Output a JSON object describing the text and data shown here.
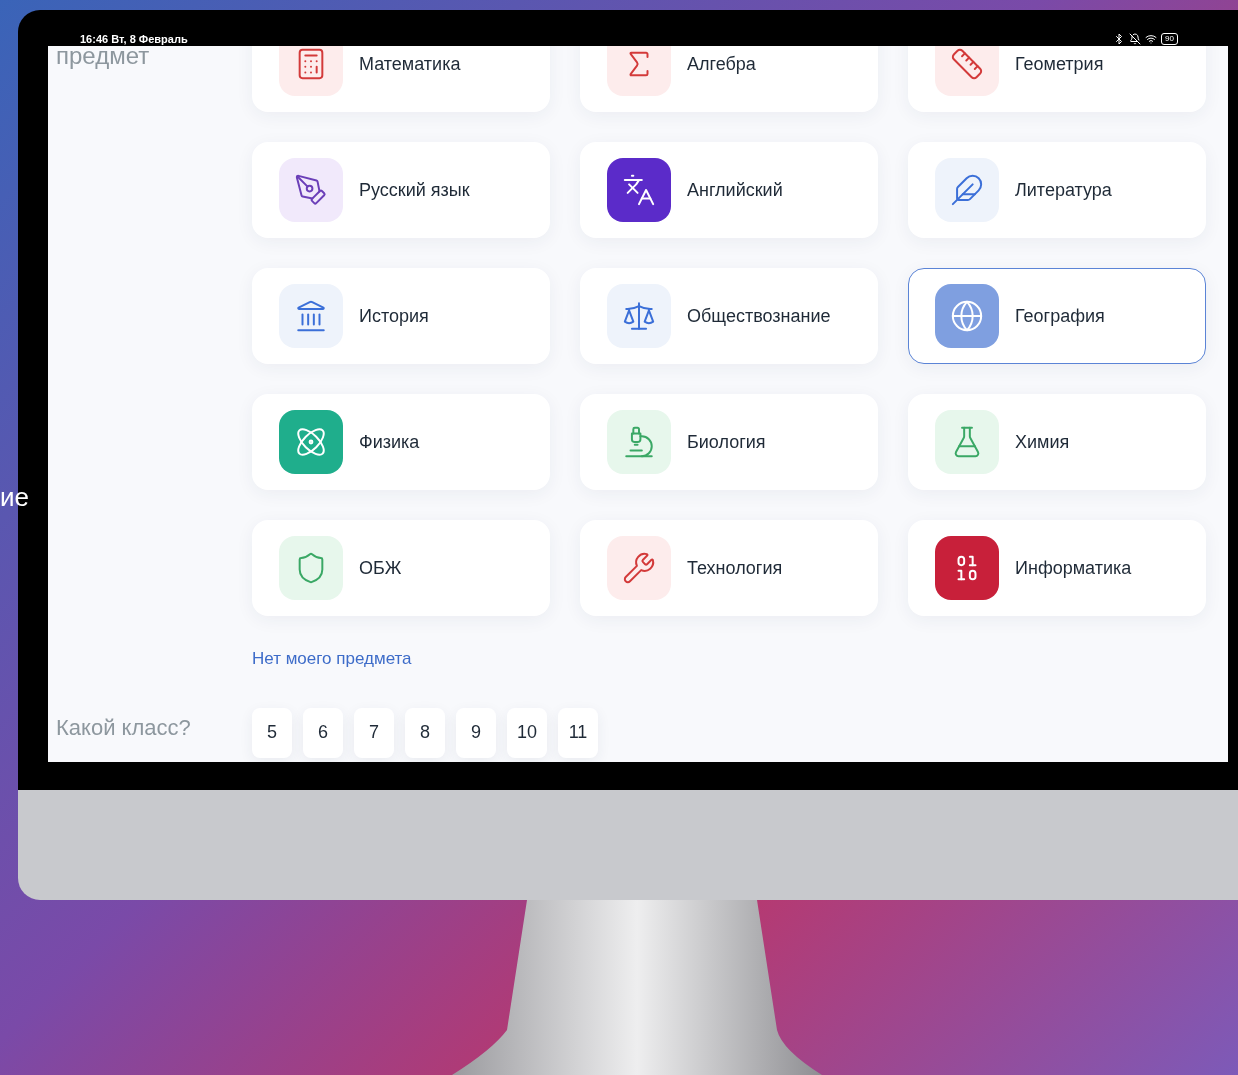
{
  "slide": {
    "text": "ие"
  },
  "status_bar": {
    "time": "16:46  Вт, 8 Февраль",
    "battery": "90"
  },
  "subject_label": "предмет",
  "subjects": [
    {
      "name": "Математика",
      "kind": "math",
      "color": "#fdecec",
      "selected": false
    },
    {
      "name": "Алгебра",
      "kind": "algebra",
      "color": "#fdecec",
      "selected": false
    },
    {
      "name": "Геометрия",
      "kind": "geometry",
      "color": "#fdecec",
      "selected": false
    },
    {
      "name": "Русский язык",
      "kind": "russian",
      "color": "#f1e9fb",
      "selected": false
    },
    {
      "name": "Английский",
      "kind": "english",
      "color": "#5b2bc9",
      "selected": false
    },
    {
      "name": "Литература",
      "kind": "literature",
      "color": "#eef3fb",
      "selected": false
    },
    {
      "name": "История",
      "kind": "history",
      "color": "#eef3fb",
      "selected": false
    },
    {
      "name": "Обществознание",
      "kind": "society",
      "color": "#eef3fb",
      "selected": false
    },
    {
      "name": "География",
      "kind": "geography",
      "color": "#7f9fe0",
      "selected": true
    },
    {
      "name": "Физика",
      "kind": "physics",
      "color": "#1fae8c",
      "selected": false
    },
    {
      "name": "Биология",
      "kind": "biology",
      "color": "#e7f7ec",
      "selected": false
    },
    {
      "name": "Химия",
      "kind": "chemistry",
      "color": "#e7f7ec",
      "selected": false
    },
    {
      "name": "ОБЖ",
      "kind": "safety",
      "color": "#e7f7ec",
      "selected": false
    },
    {
      "name": "Технология",
      "kind": "technology",
      "color": "#fdecec",
      "selected": false
    },
    {
      "name": "Информатика",
      "kind": "informatics",
      "color": "#c8203a",
      "selected": false
    }
  ],
  "missing_link": "Нет моего предмета",
  "grade_label": "Какой класс?",
  "grades": [
    {
      "label": "5",
      "selected": false
    },
    {
      "label": "6",
      "selected": false
    },
    {
      "label": "7",
      "selected": false
    },
    {
      "label": "8",
      "selected": false
    },
    {
      "label": "9",
      "selected": false
    },
    {
      "label": "10",
      "selected": false
    },
    {
      "label": "11",
      "selected": false
    }
  ]
}
